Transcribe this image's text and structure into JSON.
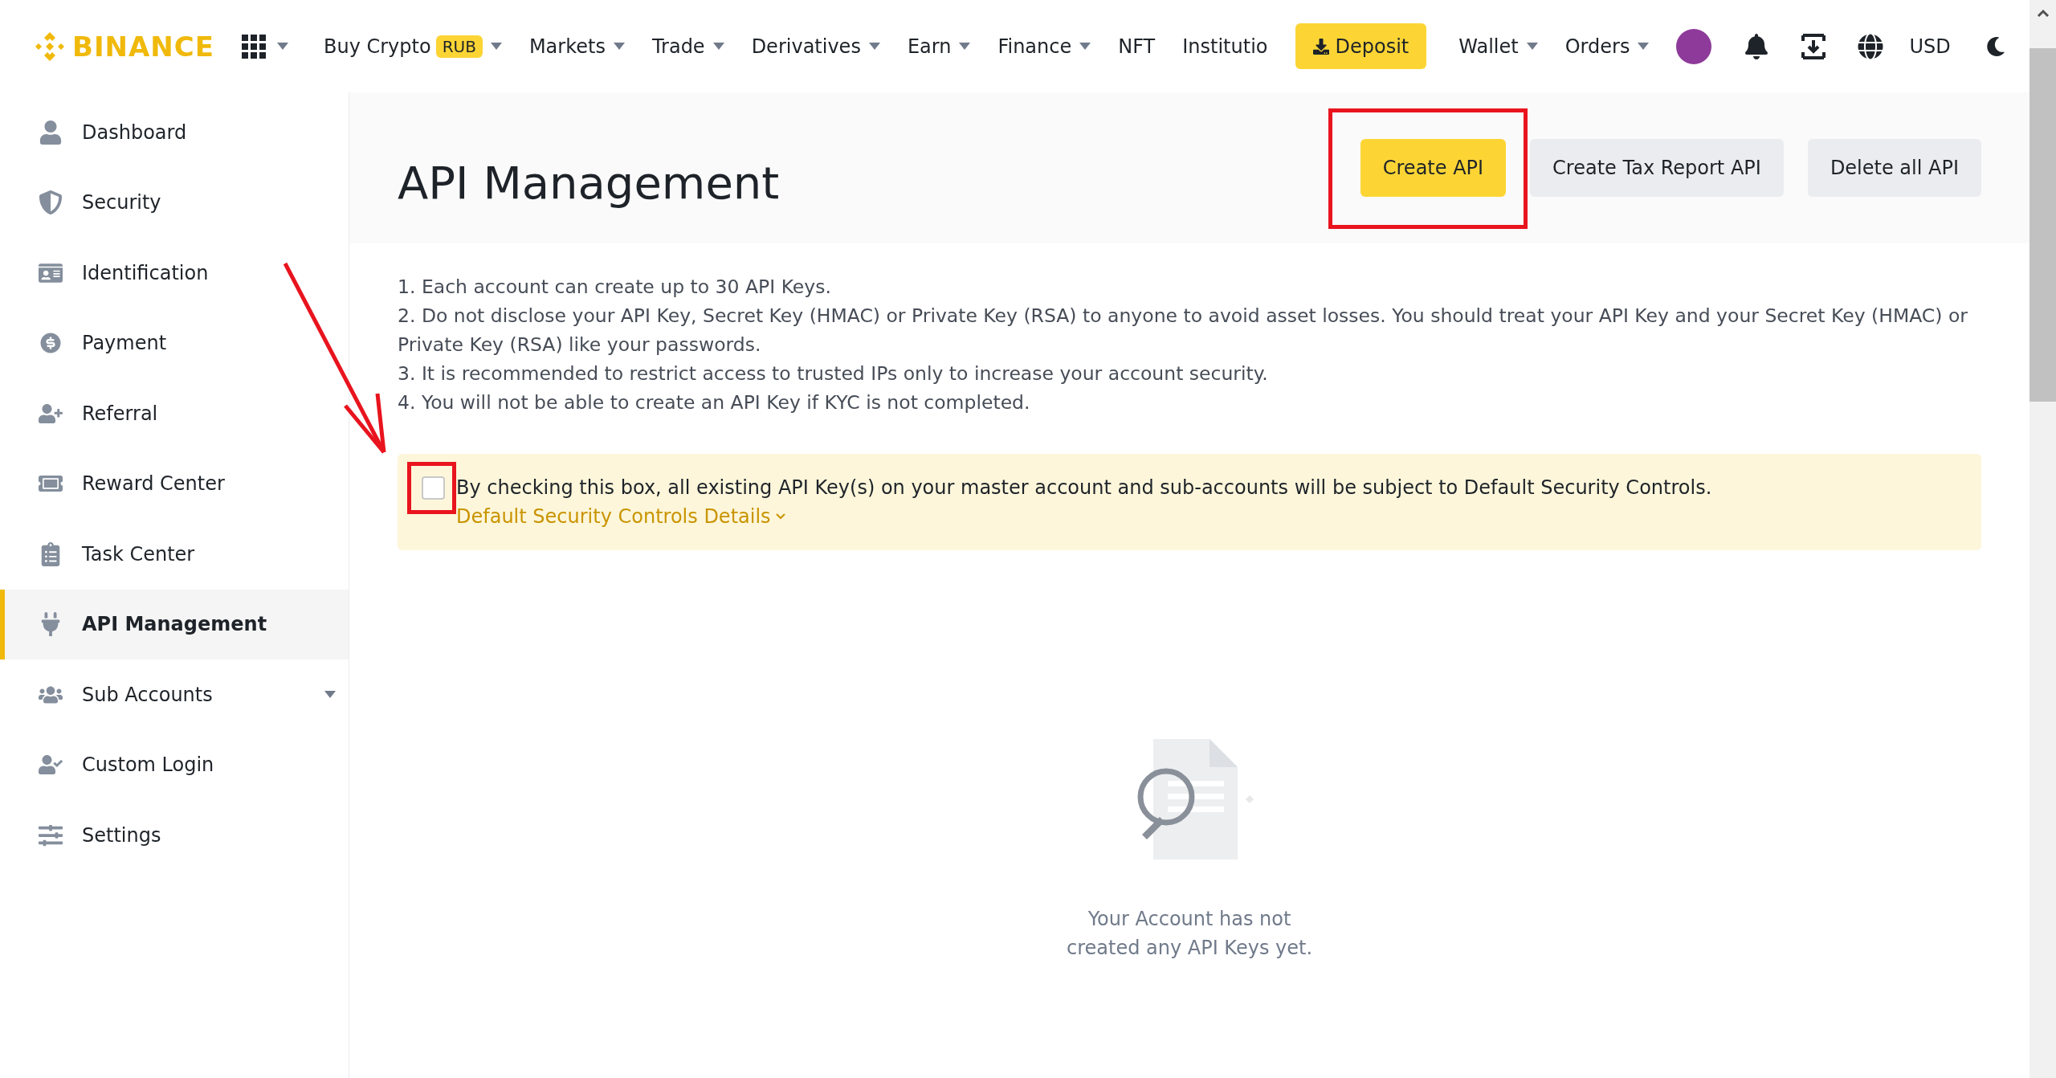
{
  "nav": {
    "logo": "BINANCE",
    "items": [
      {
        "label": "Buy Crypto",
        "badge": "RUB",
        "has_menu": true
      },
      {
        "label": "Markets",
        "has_menu": true
      },
      {
        "label": "Trade",
        "has_menu": true
      },
      {
        "label": "Derivatives",
        "has_menu": true
      },
      {
        "label": "Earn",
        "has_menu": true
      },
      {
        "label": "Finance",
        "has_menu": true
      },
      {
        "label": "NFT",
        "has_menu": false
      },
      {
        "label": "Institutio",
        "has_menu": false
      }
    ],
    "deposit": "Deposit",
    "account_items": [
      {
        "label": "Wallet",
        "has_menu": true
      },
      {
        "label": "Orders",
        "has_menu": true
      }
    ],
    "currency": "USD"
  },
  "sidebar": {
    "items": [
      {
        "label": "Dashboard",
        "selected": false,
        "has_menu": false
      },
      {
        "label": "Security",
        "selected": false,
        "has_menu": false
      },
      {
        "label": "Identification",
        "selected": false,
        "has_menu": false
      },
      {
        "label": "Payment",
        "selected": false,
        "has_menu": false
      },
      {
        "label": "Referral",
        "selected": false,
        "has_menu": false
      },
      {
        "label": "Reward Center",
        "selected": false,
        "has_menu": false
      },
      {
        "label": "Task Center",
        "selected": false,
        "has_menu": false
      },
      {
        "label": "API Management",
        "selected": true,
        "has_menu": false
      },
      {
        "label": "Sub Accounts",
        "selected": false,
        "has_menu": true
      },
      {
        "label": "Custom Login",
        "selected": false,
        "has_menu": false
      },
      {
        "label": "Settings",
        "selected": false,
        "has_menu": false
      }
    ]
  },
  "page": {
    "title": "API Management",
    "buttons": [
      {
        "label": "Create API",
        "kind": "primary"
      },
      {
        "label": "Create Tax Report API",
        "kind": "secondary"
      },
      {
        "label": "Delete all API",
        "kind": "secondary"
      }
    ],
    "notes": [
      "1. Each account can create up to 30 API Keys.",
      "2. Do not disclose your API Key, Secret Key (HMAC) or Private Key (RSA) to anyone to avoid asset losses. You should treat your API Key and your Secret Key (HMAC) or Private Key (RSA) like your passwords.",
      "3. It is recommended to restrict access to trusted IPs only to increase your account security.",
      "4. You will not be able to create an API Key if KYC is not completed."
    ],
    "notice": {
      "checked": false,
      "text": "By checking this box, all existing API Key(s) on your master account and sub-accounts will be subject to Default Security Controls.",
      "link": "Default Security Controls Details"
    },
    "empty_state": "Your Account has not created any API Keys yet."
  }
}
